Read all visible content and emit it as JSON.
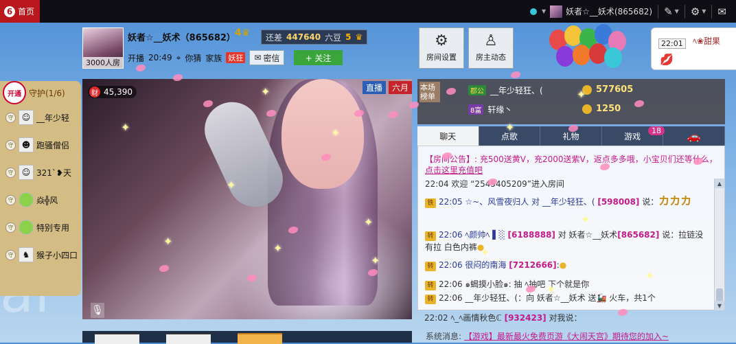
{
  "topbar": {
    "home_label": "首页",
    "logo_text": "6",
    "user_name": "妖者☆__妖术(865682)"
  },
  "anchor": {
    "name": "妖者☆__妖术（865682）",
    "room_count": "3000人房",
    "crown_level": "4",
    "gap_label": "还差",
    "gap_value": "447640",
    "gap_unit": "六豆",
    "next_level": "5",
    "start_label": "开播",
    "start_time": "20:49",
    "location": "你猜",
    "family_label": "家族",
    "family_tag": "妖狂",
    "msg_button": "密信",
    "follow_button": "+ 关注"
  },
  "tiles": [
    {
      "label": "房间设置",
      "icon": "gear-icon"
    },
    {
      "label": "房主动态",
      "icon": "user-icon"
    }
  ],
  "notify": {
    "time": "22:01",
    "text": "ﾍ❀甜果"
  },
  "guard": {
    "open_label": "开通",
    "title": "守护(1/6)",
    "items": [
      "__年少轻",
      "跑骚僧侣",
      "321`❥天",
      "焱╬风",
      "特别专用",
      "猴子小四口"
    ]
  },
  "video": {
    "cash": "45,390",
    "live_label": "直播",
    "live_label2": "六月"
  },
  "rank": {
    "label": "本场榜单",
    "rows": [
      {
        "tag": "郡公",
        "name": "__年少轻狂、(",
        "coins": "577605"
      },
      {
        "tag": "8富",
        "name": "轩缘丶",
        "coins": "1250"
      }
    ]
  },
  "tabs": [
    "聊天",
    "点歌",
    "礼物",
    "游戏",
    ""
  ],
  "tab_badge": "18",
  "chat": [
    {
      "t1": "【房间公告】: 充500送黄V，充2000送紫V，返点多多哦，小宝贝们还等什么，",
      "t2": "点击这里充值吧"
    },
    {
      "t1": "22:04 欢迎 “2545405209”进入房间"
    },
    {
      "t1": "22:05 ☆~、风雪夜归人 对 __年少轻狂、( ",
      "num": "[598008]",
      "t2": " 说：",
      "t3": "カカカ"
    },
    {
      "t1": "22:06 ﾍ颜帅ﾍ ▌░ ",
      "num": "[6188888]",
      "t2": " 对 妖者☆__妖术",
      "num2": "[865682]",
      "t3": " 说：拉链没"
    },
    {
      "t1": "有拉 白色内裤"
    },
    {
      "t1": "22:06 很闷的南海 ",
      "num": "[7212666]",
      "t2": ":"
    },
    {
      "t1": "22:06 ๑蝎摸小脸๑: 抽   ﾍ抽吧 下个就是你"
    },
    {
      "t1": "22:06 __年少轻狂、(：向 妖者☆__妖术 送",
      "t2": " 火车，共1个"
    },
    {
      "t1": "22:02 ﾍ_ﾍ画情秋色ℂ ",
      "num": "[932423]",
      "t2": " 对我说："
    }
  ],
  "system": {
    "label": "系统消息:",
    "link": "【游戏】最新最火免费页游《大闹天宫》期待您的加入~"
  },
  "colors": {
    "home_red": "#b8171b",
    "follow_green": "#3aa53a",
    "highlight_pink": "#c21a8a"
  }
}
